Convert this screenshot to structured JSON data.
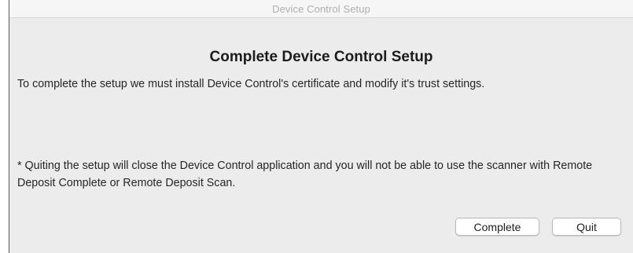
{
  "window": {
    "title": "Device Control Setup"
  },
  "dialog": {
    "heading": "Complete Device Control Setup",
    "message": "To complete the setup we must install Device Control's certificate and modify it's trust settings.",
    "note": "* Quiting the setup will close the Device Control application and you will not be able to use the scanner with Remote Deposit Complete or Remote Deposit Scan."
  },
  "buttons": {
    "complete_label": "Complete",
    "quit_label": "Quit"
  }
}
